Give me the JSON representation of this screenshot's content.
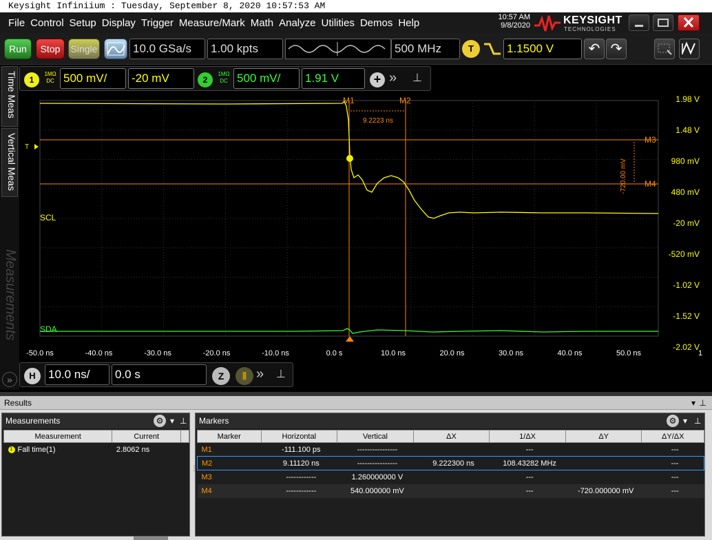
{
  "window": {
    "title": "Keysight Infiniium : Tuesday, September 8, 2020 10:57:53 AM"
  },
  "menu": [
    "File",
    "Control",
    "Setup",
    "Display",
    "Trigger",
    "Measure/Mark",
    "Math",
    "Analyze",
    "Utilities",
    "Demos",
    "Help"
  ],
  "clock": {
    "time": "10:57 AM",
    "date": "9/8/2020"
  },
  "brand": {
    "name": "KEYSIGHT",
    "sub": "TECHNOLOGIES"
  },
  "toolbar": {
    "run": "Run",
    "stop": "Stop",
    "single": "Single",
    "sample_rate": "10.0 GSa/s",
    "memory_depth": "1.00 kpts",
    "bandwidth": "500 MHz",
    "trigger_badge": "T",
    "trigger_level": "1.1500 V"
  },
  "channels": [
    {
      "num": "1",
      "coupling_top": "1MΩ",
      "coupling_bottom": "DC",
      "scale": "500 mV/",
      "offset": "-20 mV",
      "color": "#ffff00"
    },
    {
      "num": "2",
      "coupling_top": "1MΩ",
      "coupling_bottom": "DC",
      "scale": "500 mV/",
      "offset": "1.91 V",
      "color": "#33ff33"
    }
  ],
  "side_tabs": [
    "Time Meas",
    "Vertical Meas",
    "Measurements"
  ],
  "scope": {
    "y_labels": [
      "1.98 V",
      "1.48 V",
      "980 mV",
      "480 mV",
      "-20 mV",
      "-520 mV",
      "-1.02 V",
      "-1.52 V",
      "-2.02 V"
    ],
    "x_labels": [
      "-50.0 ns",
      "-40.0 ns",
      "-30.0 ns",
      "-20.0 ns",
      "-10.0 ns",
      "0.0 s",
      "10.0 ns",
      "20.0 ns",
      "30.0 ns",
      "40.0 ns",
      "50.0 ns"
    ],
    "right_number": "1",
    "labels": {
      "scl": "SCL",
      "sda": "SDA",
      "m1": "M1",
      "m2": "M2",
      "m3": "M3",
      "m4": "M4",
      "dx": "9.2223 ns",
      "dy": "-720.00 mV",
      "trig": "T"
    }
  },
  "timebase": {
    "h_badge": "H",
    "scale": "10.0 ns/",
    "position": "0.0 s"
  },
  "results": {
    "header": "Results",
    "measurements": {
      "title": "Measurements",
      "columns": [
        "Measurement",
        "Current"
      ],
      "rows": [
        {
          "name": "Fall time(1)",
          "current": "2.8062 ns"
        }
      ]
    },
    "markers": {
      "title": "Markers",
      "columns": [
        "Marker",
        "Horizontal",
        "Vertical",
        "ΔX",
        "1/ΔX",
        "ΔY",
        "ΔY/ΔX"
      ],
      "rows": [
        {
          "marker": "M1",
          "horizontal": "-111.100 ps",
          "vertical": "----------------",
          "dx": "",
          "inv_dx": "---",
          "dy": "",
          "dydx": "---"
        },
        {
          "marker": "M2",
          "horizontal": "9.11120 ns",
          "vertical": "----------------",
          "dx": "9.222300 ns",
          "inv_dx": "108.43282 MHz",
          "dy": "",
          "dydx": "---"
        },
        {
          "marker": "M3",
          "horizontal": "------------",
          "vertical": "1.260000000 V",
          "dx": "",
          "inv_dx": "---",
          "dy": "",
          "dydx": "---"
        },
        {
          "marker": "M4",
          "horizontal": "------------",
          "vertical": "540.000000 mV",
          "dx": "",
          "inv_dx": "---",
          "dy": "-720.000000 mV",
          "dydx": "---"
        }
      ]
    }
  }
}
